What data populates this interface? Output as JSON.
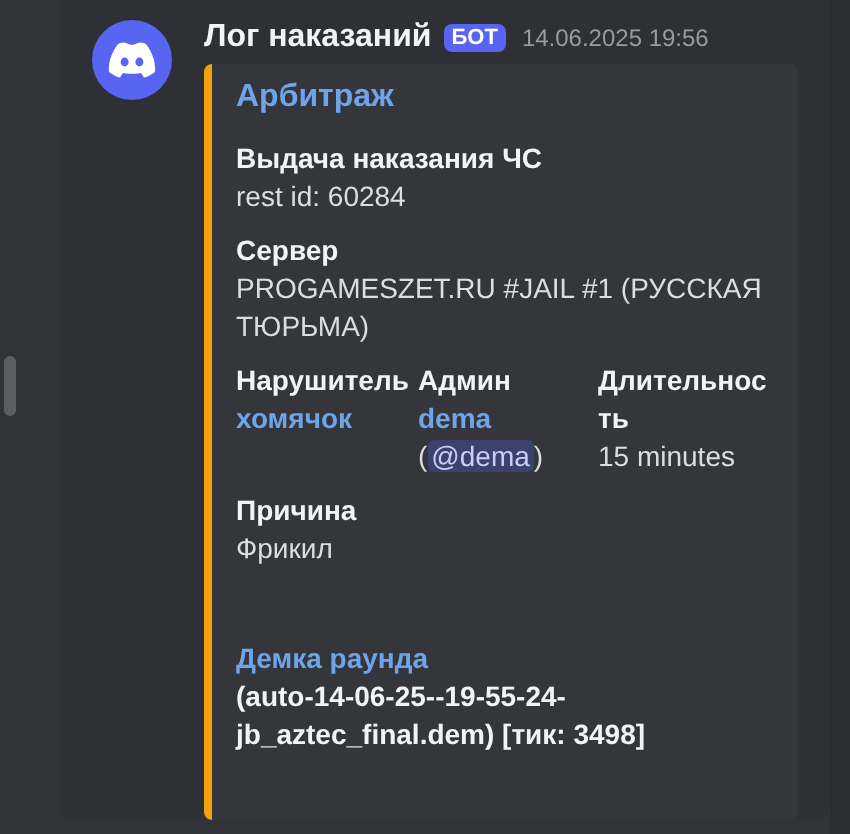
{
  "message": {
    "author": "Лог наказаний",
    "badge": "БОТ",
    "timestamp": "14.06.2025 19:56",
    "embed": {
      "color": "#f0a30a",
      "title": "Арбитраж",
      "fields": [
        {
          "kind": "block",
          "name": "Выдача наказания ЧС",
          "lines": [
            [
              {
                "kind": "text",
                "text": "rest id: 60284"
              }
            ]
          ]
        },
        {
          "kind": "block",
          "name": "Сервер",
          "lines": [
            [
              {
                "kind": "text",
                "text": "PROGAMESZET.RU #JAIL #1 (РУССКАЯ ТЮРЬМА)"
              }
            ]
          ]
        },
        {
          "kind": "inline",
          "name": "Нарушитель",
          "lines": [
            [
              {
                "kind": "link",
                "text": "хомячок"
              }
            ]
          ]
        },
        {
          "kind": "inline",
          "name": "Админ",
          "lines": [
            [
              {
                "kind": "link",
                "text": "dema"
              }
            ],
            [
              {
                "kind": "text",
                "text": "("
              },
              {
                "kind": "mention",
                "text": "@dema"
              },
              {
                "kind": "text",
                "text": ")"
              }
            ]
          ]
        },
        {
          "kind": "inline",
          "name": "Длительность",
          "lines": [
            [
              {
                "kind": "text",
                "text": "15 minutes"
              }
            ]
          ]
        },
        {
          "kind": "block",
          "name": "Причина",
          "lines": [
            [
              {
                "kind": "text",
                "text": "Фрикил"
              }
            ]
          ]
        },
        {
          "kind": "linked",
          "name": "Демка раунда",
          "lines": [
            [
              {
                "kind": "text",
                "text": "(auto-14-06-25--19-55-24-jb_aztec_final.dem) [тик: 3498]"
              }
            ]
          ]
        }
      ]
    }
  }
}
